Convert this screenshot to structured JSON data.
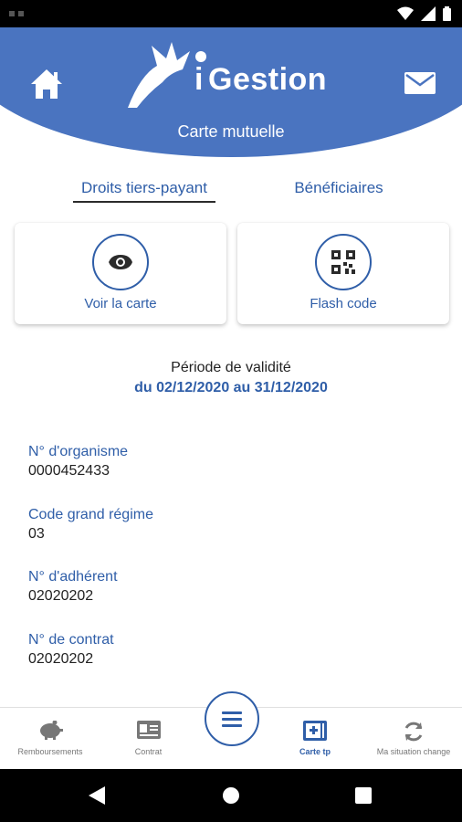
{
  "app": {
    "logo_text": "Gestion",
    "logo_i": "i",
    "page_title": "Carte mutuelle"
  },
  "tabs": [
    {
      "label": "Droits tiers-payant",
      "active": true
    },
    {
      "label": "Bénéficiaires",
      "active": false
    }
  ],
  "cards": [
    {
      "label": "Voir la carte",
      "icon": "eye-icon"
    },
    {
      "label": "Flash code",
      "icon": "qr-code-icon"
    }
  ],
  "validity": {
    "label": "Période de validité",
    "range": "du 02/12/2020 au 31/12/2020"
  },
  "fields": [
    {
      "label": "N° d'organisme",
      "value": "0000452433"
    },
    {
      "label": "Code grand régime",
      "value": "03"
    },
    {
      "label": "N° d'adhérent",
      "value": "02020202"
    },
    {
      "label": "N° de contrat",
      "value": "02020202"
    }
  ],
  "bottom_nav": [
    {
      "label": "Remboursements",
      "icon": "piggy-bank-icon",
      "active": false
    },
    {
      "label": "Contrat",
      "icon": "id-card-icon",
      "active": false
    },
    {
      "label": "Carte tp",
      "icon": "medical-card-icon",
      "active": true
    },
    {
      "label": "Ma situation change",
      "icon": "refresh-icon",
      "active": false
    }
  ],
  "colors": {
    "brand_blue": "#4a74c0",
    "accent_blue": "#2f5ea8",
    "text_dark": "#222222"
  }
}
